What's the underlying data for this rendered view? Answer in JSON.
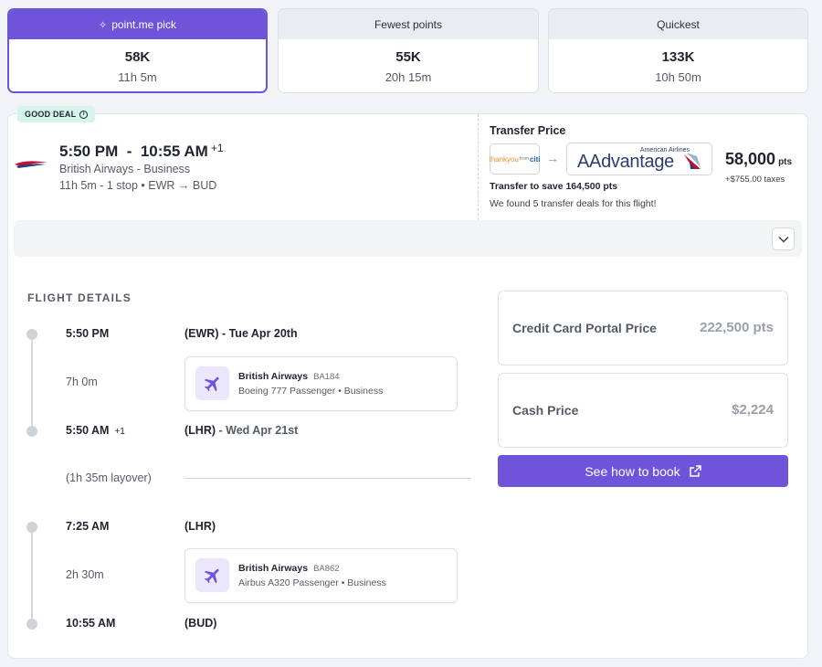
{
  "tabs": [
    {
      "label": "point.me pick",
      "points": "58K",
      "duration": "11h 5m",
      "active": true
    },
    {
      "label": "Fewest points",
      "points": "55K",
      "duration": "20h 15m",
      "active": false
    },
    {
      "label": "Quickest",
      "points": "133K",
      "duration": "10h 50m",
      "active": false
    }
  ],
  "flight": {
    "badge": "GOOD DEAL",
    "depart_time": "5:50 PM",
    "separator": "-",
    "arrive_time": "10:55 AM",
    "day_offset": "+1",
    "airline_cabin": "British Airways - Business",
    "summary": "11h 5m - 1 stop",
    "route": "EWR → BUD"
  },
  "transfer": {
    "title": "Transfer Price",
    "from_program": "thankyou",
    "from_program_sub": "from",
    "from_bank": "citi",
    "to_program_small": "American Airlines",
    "to_program": "AAdvantage",
    "points": "58,000",
    "points_unit": "pts",
    "taxes": "+$755.00 taxes",
    "save_text": "Transfer to save 164,500 pts",
    "found_text": "We found 5 transfer deals for this flight!"
  },
  "details": {
    "title": "FLIGHT DETAILS",
    "stops": [
      {
        "time": "5:50 PM",
        "offset": "",
        "place": "(EWR) - Tue Apr 20th"
      },
      {
        "time": "5:50 AM",
        "offset": "+1",
        "place": "(LHR)",
        "date": " - Wed Apr 21st"
      },
      {
        "time": "7:25 AM",
        "offset": "",
        "place": "(LHR)"
      },
      {
        "time": "10:55 AM",
        "offset": "",
        "place": "(BUD)"
      }
    ],
    "segments": [
      {
        "duration": "7h 0m",
        "airline": "British Airways",
        "flight_no": "BA184",
        "aircraft": "Boeing 777 Passenger • Business"
      },
      {
        "duration": "2h 30m",
        "airline": "British Airways",
        "flight_no": "BA862",
        "aircraft": "Airbus A320 Passenger • Business"
      }
    ],
    "layover": "(1h 35m layover)"
  },
  "prices": {
    "portal_label": "Credit Card Portal Price",
    "portal_value": "222,500 pts",
    "cash_label": "Cash Price",
    "cash_value": "$2,224",
    "book_label": "See how to book"
  },
  "colors": {
    "accent": "#6d54d9",
    "badge_bg": "#d5f5ec"
  },
  "icons": [
    "sparkle-icon",
    "info-icon",
    "british-airways-logo",
    "arrow-right-icon",
    "aa-eagle-logo",
    "chevron-down-icon",
    "plane-icon",
    "external-link-icon"
  ]
}
